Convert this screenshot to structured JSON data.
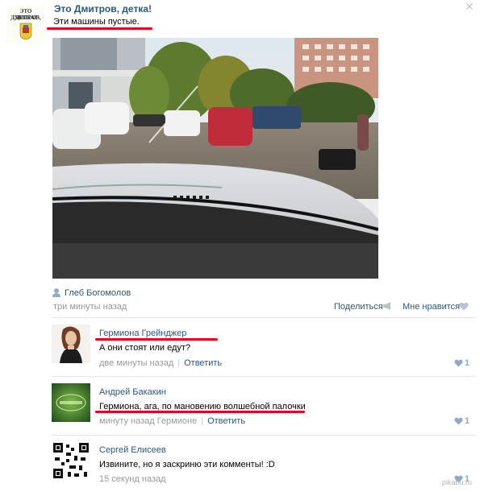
{
  "post": {
    "group_avatar_line1": "ЭТО ДМИТРОВ,",
    "group_avatar_line2": "ДЕТКА!",
    "group_name": "Это Дмитров, детка!",
    "text": "Эти машины пустые.",
    "author": "Глеб Богомолов",
    "time": "три минуты назад",
    "share_label": "Поделиться",
    "like_label": "Мне нравится",
    "close_icon": "close-icon",
    "photo_alt_icon": "car-hood-photo"
  },
  "comments": [
    {
      "name": "Гермиона Грейнджер",
      "text": "А они стоят или едут?",
      "time": "две минуты назад",
      "reply": "Ответить",
      "likes": "1"
    },
    {
      "name": "Андрей Бакакин",
      "text": "Гермиона, ага, по мановению волшебной палочки",
      "time": "минуту назад",
      "reply_to": "Гермионе",
      "reply": "Ответить",
      "likes": "1"
    },
    {
      "name": "Сергей Елисеев",
      "text": "Извините, но я заскриню эти комменты! :D",
      "time": "15 секунд назад",
      "likes": "1"
    }
  ],
  "watermark": "pikabu.ru",
  "colors": {
    "link": "#2b587a",
    "muted": "#999999",
    "underline_marker": "#e8001b",
    "like_heart": "#8fa9c6"
  }
}
